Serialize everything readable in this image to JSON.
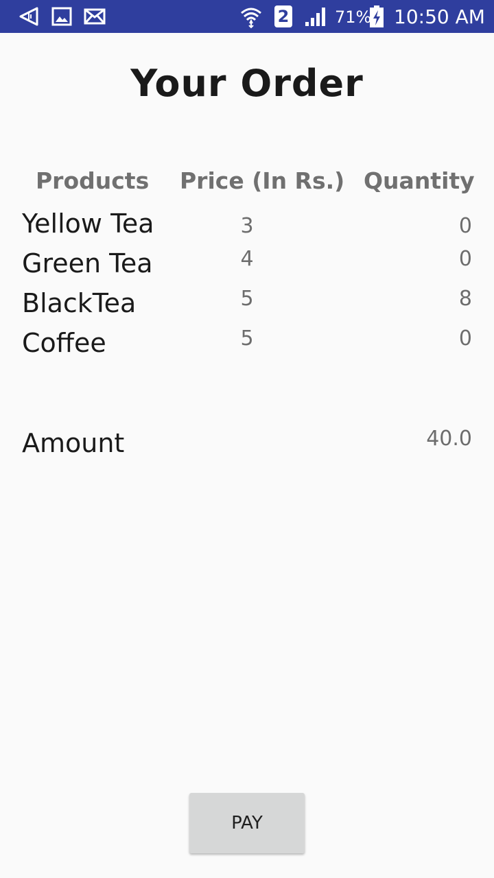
{
  "status_bar": {
    "sim_slot": "2",
    "battery": "71%",
    "time": "10:50 AM",
    "icons": [
      "navigation-arrow-icon",
      "image-icon",
      "mail-icon",
      "wifi-icon",
      "sim-icon",
      "signal-icon",
      "battery-charging-icon"
    ]
  },
  "screen": {
    "title": "Your Order",
    "headers": {
      "products": "Products",
      "price": "Price (In Rs.)",
      "quantity": "Quantity"
    },
    "items": [
      {
        "name": "Yellow Tea",
        "price": "3",
        "quantity": "0"
      },
      {
        "name": "Green Tea",
        "price": "4",
        "quantity": "0"
      },
      {
        "name": "BlackTea",
        "price": "5",
        "quantity": "8"
      },
      {
        "name": "Coffee",
        "price": "5",
        "quantity": "0"
      }
    ],
    "amount_label": "Amount",
    "amount_value": "40.0",
    "pay_label": "PAY"
  },
  "colors": {
    "status_bar": "#2f3e9e",
    "background": "#fafafa",
    "primary_text": "#1a1a1a",
    "secondary_text": "#6d6d6d",
    "button": "#d6d7d7"
  }
}
